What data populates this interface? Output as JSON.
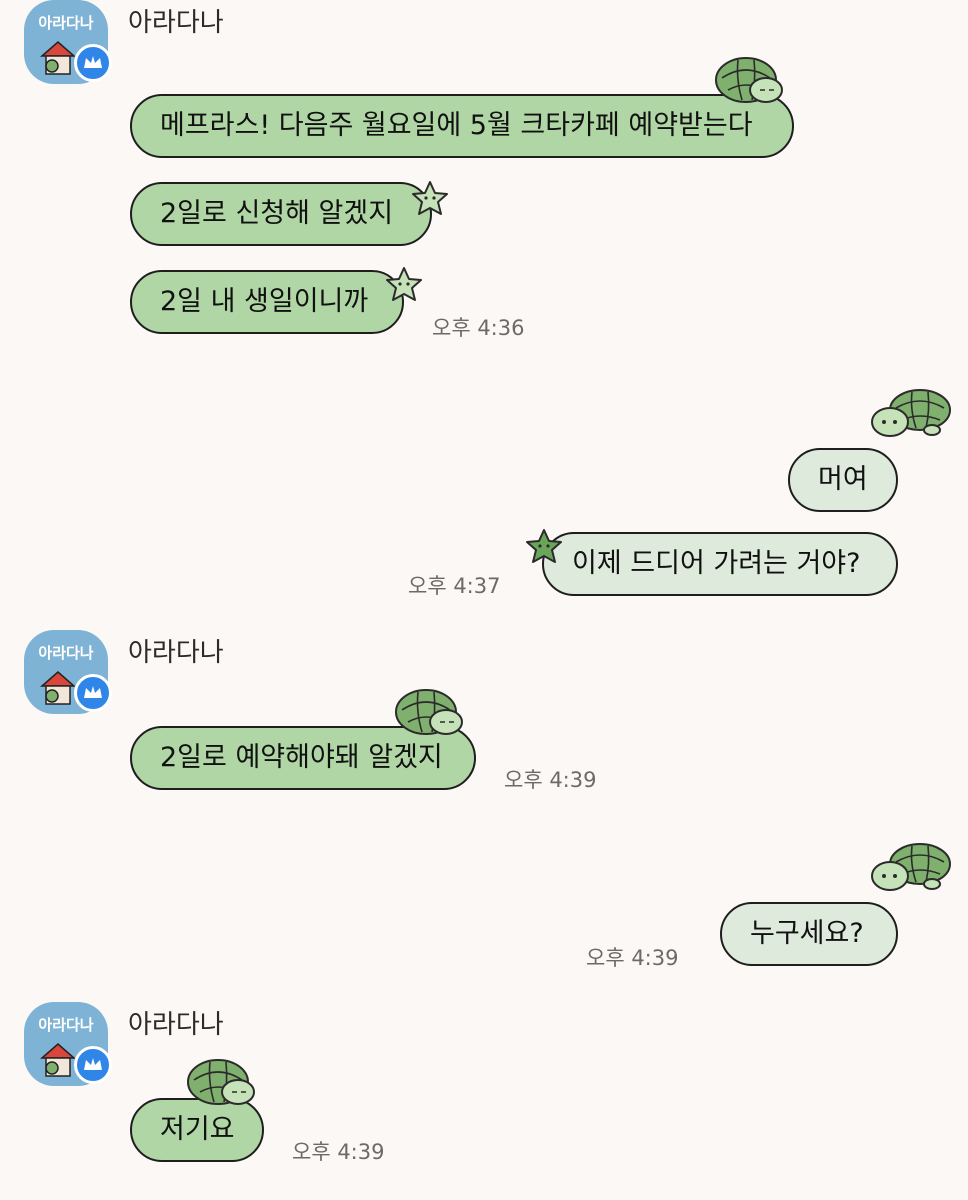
{
  "chat": {
    "sender_name": "아라다나",
    "avatar_label": "아라다나",
    "groups": [
      {
        "name": "아라다나",
        "messages": [
          "메프라스! 다음주 월요일에 5월 크타카페 예약받는다",
          "2일로 신청해 알겠지",
          "2일 내 생일이니까"
        ],
        "time": "오후 4:36"
      },
      {
        "messages": [
          "머여",
          "이제 드디어 가려는 거야?"
        ],
        "time": "오후 4:37"
      },
      {
        "name": "아라다나",
        "messages": [
          "2일로 예약해야돼 알겠지"
        ],
        "time": "오후 4:39"
      },
      {
        "messages": [
          "누구세요?"
        ],
        "time": "오후 4:39"
      },
      {
        "name": "아라다나",
        "messages": [
          "저기요"
        ],
        "time": "오후 4:39"
      }
    ]
  },
  "colors": {
    "background": "#fcf8f6",
    "incoming_bubble": "#b1d6a6",
    "outgoing_bubble": "#deeadb",
    "avatar": "#7fb3d6",
    "badge": "#2f86e8"
  },
  "icons": [
    "turtle-sticker-icon",
    "star-sticker-icon",
    "crown-icon",
    "house-icon"
  ]
}
